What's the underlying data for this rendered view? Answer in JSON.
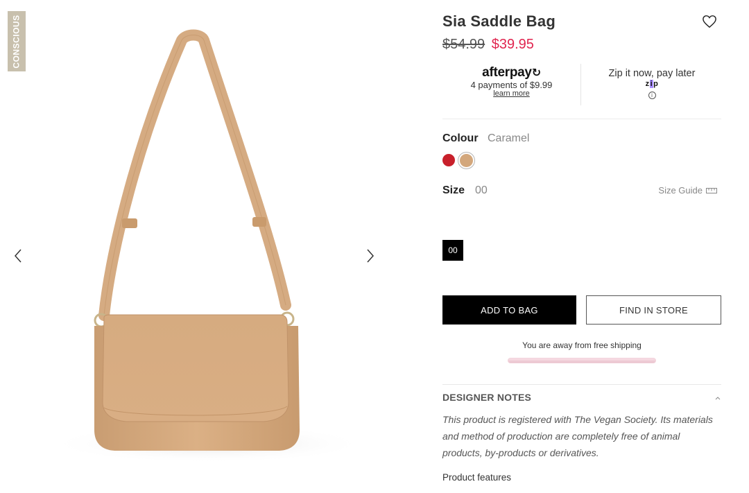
{
  "gallery": {
    "badge": "CONSCIOUS",
    "prev_icon": "chevron-left-icon",
    "next_icon": "chevron-right-icon"
  },
  "product": {
    "title": "Sia Saddle Bag",
    "price_old": "$54.99",
    "price_new": "$39.95",
    "price_color": "#e0254f"
  },
  "payments": {
    "afterpay": {
      "logo": "afterpay",
      "text": "4 payments of $9.99",
      "link": "learn more"
    },
    "zip": {
      "text": "Zip it now, pay later",
      "logo_z": "z",
      "logo_i": "i",
      "logo_p": "p",
      "info_symbol": "i"
    }
  },
  "colour": {
    "label": "Colour",
    "selected": "Caramel",
    "swatches": [
      {
        "name": "red",
        "hex": "#c8202b"
      },
      {
        "name": "caramel",
        "hex": "#d3a77c"
      }
    ]
  },
  "size": {
    "label": "Size",
    "selected": "00",
    "guide_label": "Size Guide",
    "options": [
      "00"
    ]
  },
  "actions": {
    "add_to_bag": "ADD TO BAG",
    "find_in_store": "FIND IN STORE"
  },
  "shipping": {
    "text": "You are away from free shipping",
    "progress": 0
  },
  "designer_notes": {
    "title": "DESIGNER NOTES",
    "body": "This product is registered with The Vegan Society. Its materials and method of production are completely free of animal products, by-products or derivatives.",
    "features_title": "Product features"
  }
}
